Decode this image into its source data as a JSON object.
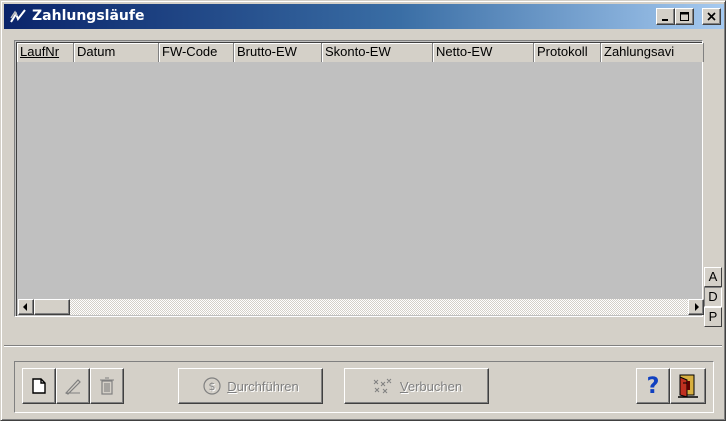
{
  "window": {
    "title": "Zahlungsläufe",
    "controls": {
      "minimize": "_",
      "maximize": "□",
      "close": "×"
    }
  },
  "listview": {
    "columns": [
      {
        "label": "LaufNr",
        "sorted": true
      },
      {
        "label": "Datum",
        "sorted": false
      },
      {
        "label": "FW-Code",
        "sorted": false
      },
      {
        "label": "Brutto-EW",
        "sorted": false
      },
      {
        "label": "Skonto-EW",
        "sorted": false
      },
      {
        "label": "Netto-EW",
        "sorted": false
      },
      {
        "label": "Protokoll",
        "sorted": false
      },
      {
        "label": "Zahlungsavi",
        "sorted": false
      }
    ],
    "rows": []
  },
  "side_buttons": {
    "a": "A",
    "d": "D",
    "p": "P"
  },
  "toolbar": {
    "new_icon": "new-document-icon",
    "edit_icon": "edit-pen-icon",
    "delete_icon": "trash-icon",
    "run": {
      "mnemonic": "D",
      "rest": "urchführen",
      "icon": "dollar-coin-icon",
      "enabled": false
    },
    "book": {
      "mnemonic": "V",
      "rest": "erbuchen",
      "icon": "booking-icon",
      "enabled": false
    },
    "help_label": "?",
    "exit_icon": "exit-door-icon"
  },
  "colors": {
    "title_start": "#0a246a",
    "title_end": "#a6caf0",
    "list_bg": "#c0c0c0",
    "face": "#d4d0c8",
    "help": "#1040c0"
  }
}
